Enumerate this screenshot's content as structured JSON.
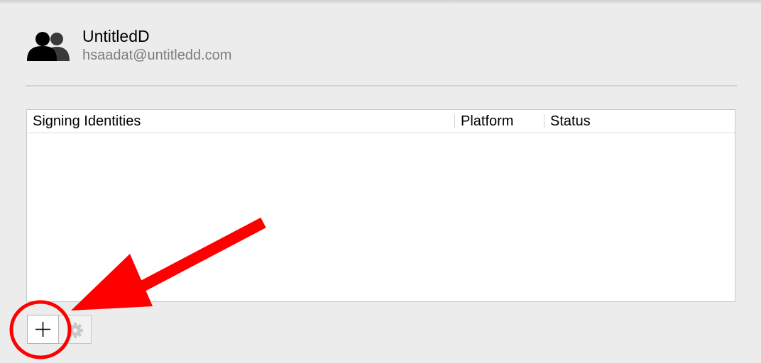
{
  "account": {
    "name": "UntitledD",
    "email": "hsaadat@untitledd.com",
    "icon": "users-icon"
  },
  "identities_table": {
    "columns": [
      "Signing Identities",
      "Platform",
      "Status"
    ],
    "rows": []
  },
  "toolbar": {
    "add_icon": "plus-icon",
    "action_icon": "gear-icon"
  },
  "annotation": {
    "color": "#ff0000",
    "shapes": [
      "arrow",
      "circle"
    ]
  }
}
